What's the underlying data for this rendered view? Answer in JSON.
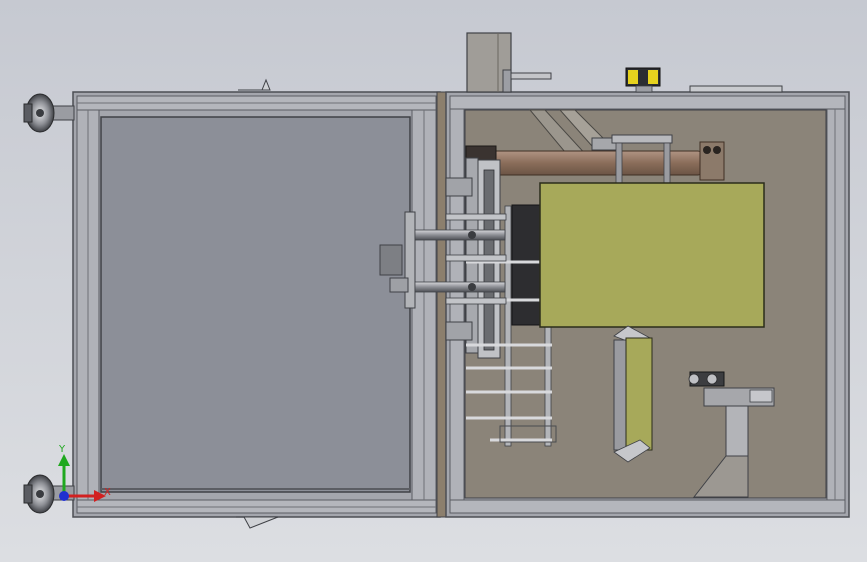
{
  "viewport": {
    "background_top": "#c9ccd3",
    "background_bottom": "#d9dbe0"
  },
  "colors": {
    "frame_profile": "#9a9ca3",
    "frame_dark": "#5e6066",
    "glass_panel": "#8d9099",
    "cabinet_interior": "#8a8378",
    "olive_module": "#a7a95a",
    "rod_bronze": "#8f7562",
    "axis_x": "#d22020",
    "axis_y": "#1fa81f",
    "axis_z": "#2030d0",
    "sensor_yellow": "#e6d21e"
  },
  "icons": {
    "triad": "xyz-triad-icon",
    "caster_top": "caster-wheel-icon",
    "caster_bottom": "caster-wheel-icon"
  },
  "triad": {
    "x_label": "X",
    "y_label": "Y"
  }
}
